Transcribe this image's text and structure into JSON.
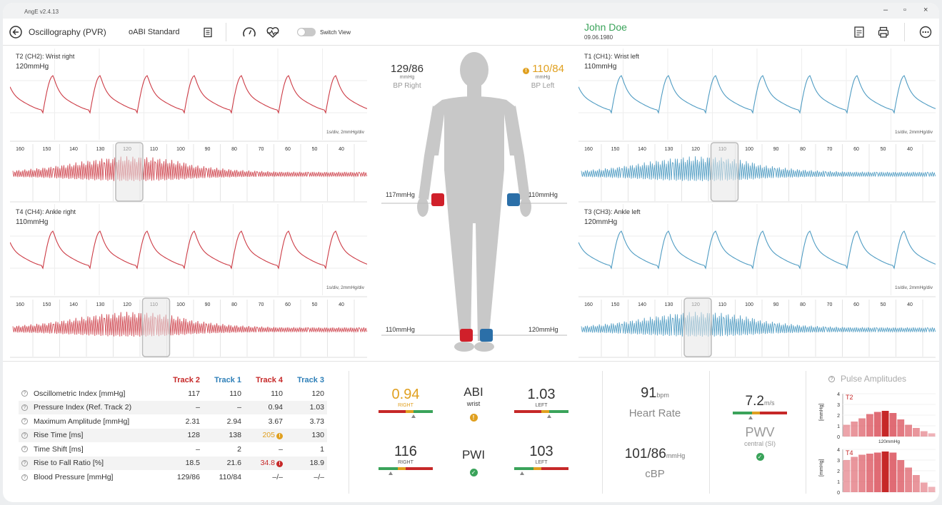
{
  "app": {
    "version": "AngE v2.4.13",
    "win_min": "–",
    "win_max": "▫",
    "win_close": "×"
  },
  "toolbar": {
    "title": "Oscillography (PVR)",
    "mode": "oABI Standard",
    "switch_label": "Switch View",
    "pdf_label": "PDF"
  },
  "patient": {
    "name": "John Doe",
    "dob": "09.06.1980"
  },
  "panels": {
    "t2": {
      "title": "T2 (CH2): Wrist right",
      "pressure": "120mmHg",
      "scale": "1s/div, 2mmHg/div",
      "ticks": [
        "160",
        "150",
        "140",
        "130",
        "120",
        "110",
        "100",
        "90",
        "80",
        "70",
        "60",
        "50",
        "40"
      ],
      "selected": "120"
    },
    "t4": {
      "title": "T4 (CH4): Ankle right",
      "pressure": "110mmHg",
      "scale": "1s/div, 2mmHg/div",
      "ticks": [
        "160",
        "150",
        "140",
        "130",
        "120",
        "110",
        "100",
        "90",
        "80",
        "70",
        "60",
        "50",
        "40"
      ],
      "selected": "110"
    },
    "t1": {
      "title": "T1 (CH1): Wrist left",
      "pressure": "110mmHg",
      "scale": "1s/div, 2mmHg/div",
      "ticks": [
        "160",
        "150",
        "140",
        "130",
        "120",
        "110",
        "100",
        "90",
        "80",
        "70",
        "60",
        "50",
        "40"
      ],
      "selected": "110"
    },
    "t3": {
      "title": "T3 (CH3): Ankle left",
      "pressure": "120mmHg",
      "scale": "1s/div, 2mmHg/div",
      "ticks": [
        "160",
        "150",
        "140",
        "130",
        "120",
        "110",
        "100",
        "90",
        "80",
        "70",
        "60",
        "50",
        "40"
      ],
      "selected": "120"
    }
  },
  "body": {
    "bp_right": {
      "value": "129/86",
      "unit": "mmHg",
      "label": "BP Right"
    },
    "bp_left": {
      "value": "110/84",
      "unit": "mmHg",
      "label": "BP Left",
      "warn": "!"
    },
    "arm_right": "117mmHg",
    "arm_left": "110mmHg",
    "ankle_right": "110mmHg",
    "ankle_left": "120mmHg"
  },
  "colors": {
    "track2": "#c62828",
    "track1": "#2e7fb8",
    "track4": "#c62828",
    "track3": "#2e7fb8",
    "green": "#3aa35a",
    "orange": "#e0a020",
    "right_wave": "#cc3a44",
    "left_wave": "#4e9bc2"
  },
  "table": {
    "headers": [
      "Track 2",
      "Track 1",
      "Track 4",
      "Track 3"
    ],
    "rows": [
      {
        "label": "Oscillometric Index [mmHg]",
        "v": [
          "117",
          "110",
          "110",
          "120"
        ]
      },
      {
        "label": "Pressure Index (Ref. Track 2)",
        "v": [
          "–",
          "–",
          "0.94",
          "1.03"
        ]
      },
      {
        "label": "Maximum Amplitude [mmHg]",
        "v": [
          "2.31",
          "2.94",
          "3.67",
          "3.73"
        ]
      },
      {
        "label": "Rise Time [ms]",
        "v": [
          "128",
          "138",
          "205",
          "130"
        ]
      },
      {
        "label": "Time Shift [ms]",
        "v": [
          "–",
          "2",
          "–",
          "1"
        ]
      },
      {
        "label": "Rise to Fall Ratio [%]",
        "v": [
          "18.5",
          "21.6",
          "34.8",
          "18.9"
        ]
      },
      {
        "label": "Blood Pressure [mmHg]",
        "v": [
          "129/86",
          "110/84",
          "–/–",
          "–/–"
        ]
      }
    ]
  },
  "indices": {
    "abi_right": {
      "value": "0.94",
      "label": "RIGHT"
    },
    "abi": {
      "title": "ABI",
      "sub": "wrist",
      "status": "!"
    },
    "abi_left": {
      "value": "1.03",
      "label": "LEFT"
    },
    "pwi_right": {
      "value": "116",
      "label": "RIGHT"
    },
    "pwi": {
      "title": "PWI",
      "status": "✓"
    },
    "pwi_left": {
      "value": "103",
      "label": "LEFT"
    },
    "hr": {
      "value": "91",
      "unit": "bpm",
      "label": "Heart Rate"
    },
    "cbp": {
      "value": "101/86",
      "unit": "mmHg",
      "label": "cBP"
    },
    "pwv": {
      "value": "7.2",
      "unit": "m/s",
      "label": "PWV",
      "sub": "central (SI)",
      "status": "✓"
    }
  },
  "pulse_amp": {
    "title": "Pulse Amplitudes",
    "axis_label": "[mmHg]",
    "charts": [
      {
        "name": "T2",
        "note": "120mmHg",
        "yticks": [
          "0",
          "1",
          "2",
          "3",
          "4"
        ],
        "values": [
          1.1,
          1.4,
          1.7,
          2.1,
          2.3,
          2.4,
          2.2,
          1.6,
          1.1,
          0.8,
          0.5,
          0.3
        ],
        "selected": 5
      },
      {
        "name": "T4",
        "note": "",
        "yticks": [
          "0",
          "1",
          "2",
          "3",
          "4"
        ],
        "values": [
          3.0,
          3.3,
          3.5,
          3.6,
          3.7,
          3.8,
          3.7,
          3.0,
          2.3,
          1.6,
          0.9,
          0.5
        ],
        "selected": 5
      }
    ]
  }
}
